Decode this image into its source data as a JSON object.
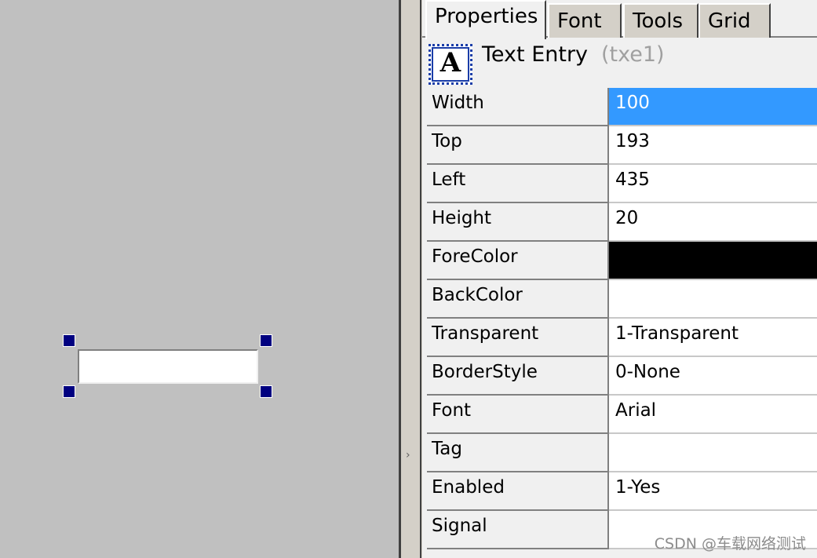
{
  "tabs": [
    "Properties",
    "Font",
    "Tools",
    "Grid"
  ],
  "object": {
    "icon_letter": "A",
    "name": "Text Entry",
    "id": "(txe1)"
  },
  "properties": [
    {
      "name": "Width",
      "value": "100"
    },
    {
      "name": "Top",
      "value": "193"
    },
    {
      "name": "Left",
      "value": "435"
    },
    {
      "name": "Height",
      "value": "20"
    },
    {
      "name": "ForeColor",
      "value": ""
    },
    {
      "name": "BackColor",
      "value": ""
    },
    {
      "name": "Transparent",
      "value": "1-Transparent"
    },
    {
      "name": "BorderStyle",
      "value": "0-None"
    },
    {
      "name": "Font",
      "value": "Arial"
    },
    {
      "name": "Tag",
      "value": ""
    },
    {
      "name": "Enabled",
      "value": "1-Yes"
    },
    {
      "name": "Signal",
      "value": ""
    }
  ],
  "colors": {
    "selection": "#3399ff",
    "forecolor_swatch": "#000000",
    "handle": "#000080"
  },
  "watermark": "CSDN @车载网络测试"
}
